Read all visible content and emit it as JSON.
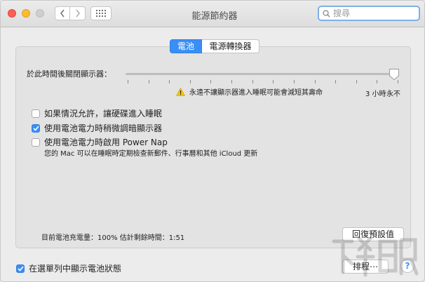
{
  "window": {
    "title": "能源節約器",
    "search_placeholder": "搜尋"
  },
  "tabs": [
    {
      "label": "電池",
      "active": true
    },
    {
      "label": "電源轉換器",
      "active": false
    }
  ],
  "display_sleep": {
    "label": "於此時間後關閉顯示器：",
    "warning": "永遠不讓顯示器進入睡眠可能會減短其壽命",
    "tick_labels": [
      "3 小時",
      "永不"
    ],
    "value_fraction": 1.0
  },
  "options": [
    {
      "label": "如果情況允許，讓硬碟進入睡眠",
      "checked": false
    },
    {
      "label": "使用電池電力時稍微調暗顯示器",
      "checked": true
    },
    {
      "label": "使用電池電力時啟用 Power Nap",
      "checked": false
    }
  ],
  "power_nap_desc": "您的 Mac 可以在睡眠時定期檢查新郵件、行事曆和其他 iCloud 更新",
  "status": "目前電池充電量：100%  估計剩餘時間：1:51",
  "buttons": {
    "restore": "回復預設值",
    "schedule": "排程⋯",
    "help": "?"
  },
  "menu_bar_option": {
    "label": "在選單列中顯示電池狀態",
    "checked": true
  },
  "colors": {
    "accent": "#3a8ef6",
    "warning": "#f5c400"
  }
}
